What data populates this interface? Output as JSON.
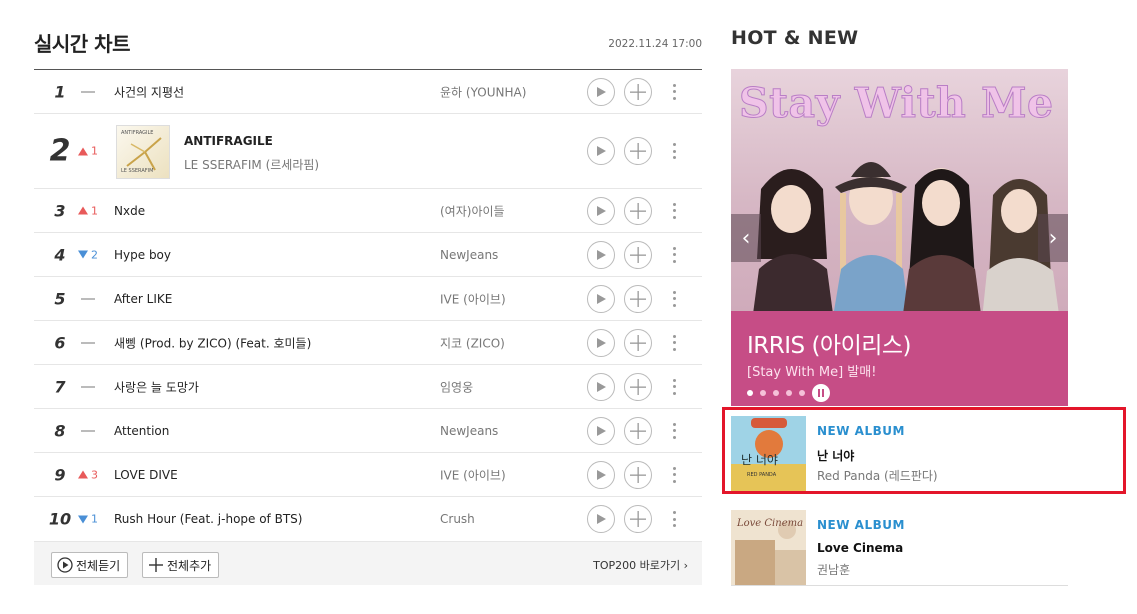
{
  "chart": {
    "title": "실시간 차트",
    "timestamp": "2022.11.24  17:00",
    "rows": [
      {
        "rank": "1",
        "change": "",
        "title": "사건의 지평선",
        "artist": "윤하 (YOUNHA)"
      },
      {
        "rank": "2",
        "change": "1",
        "title": "ANTIFRAGILE",
        "artist": "LE SSERAFIM (르세라핌)",
        "art_top": "ANTIFRAGILE",
        "art_bottom": "LE SSERAFIM"
      },
      {
        "rank": "3",
        "change": "1",
        "title": "Nxde",
        "artist": "(여자)아이들"
      },
      {
        "rank": "4",
        "change": "2",
        "title": "Hype boy",
        "artist": "NewJeans"
      },
      {
        "rank": "5",
        "change": "",
        "title": "After LIKE",
        "artist": "IVE (아이브)"
      },
      {
        "rank": "6",
        "change": "",
        "title": "새삥 (Prod. by ZICO) (Feat. 호미들)",
        "artist": "지코 (ZICO)"
      },
      {
        "rank": "7",
        "change": "",
        "title": "사랑은 늘 도망가",
        "artist": "임영웅"
      },
      {
        "rank": "8",
        "change": "",
        "title": "Attention",
        "artist": "NewJeans"
      },
      {
        "rank": "9",
        "change": "3",
        "title": "LOVE DIVE",
        "artist": "IVE (아이브)"
      },
      {
        "rank": "10",
        "change": "1",
        "title": "Rush Hour (Feat. j-hope of BTS)",
        "artist": "Crush"
      }
    ],
    "footer": {
      "play_all": "전체듣기",
      "add_all": "전체추가",
      "top200": "TOP200 바로가기 ›"
    }
  },
  "hot": {
    "title": "HOT & NEW",
    "banner": {
      "headline": "Stay With Me",
      "artist": "IRRIS (아이리스)",
      "subtitle": "[Stay With Me] 발매!"
    },
    "albums": [
      {
        "label": "NEW ALBUM",
        "title": "난 너야",
        "artist": "Red Panda (레드판다)",
        "cover_text": "난 너야",
        "cover_sub": "RED PANDA"
      },
      {
        "label": "NEW ALBUM",
        "title": "Love Cinema",
        "artist": "권남훈",
        "cover_text": "Love Cinema"
      }
    ]
  },
  "colors": {
    "up": "#e85a5a",
    "down": "#4a8fd6",
    "accent_blue": "#2a8fcf",
    "banner_pink": "#c64d86",
    "highlight": "#e3162a"
  }
}
